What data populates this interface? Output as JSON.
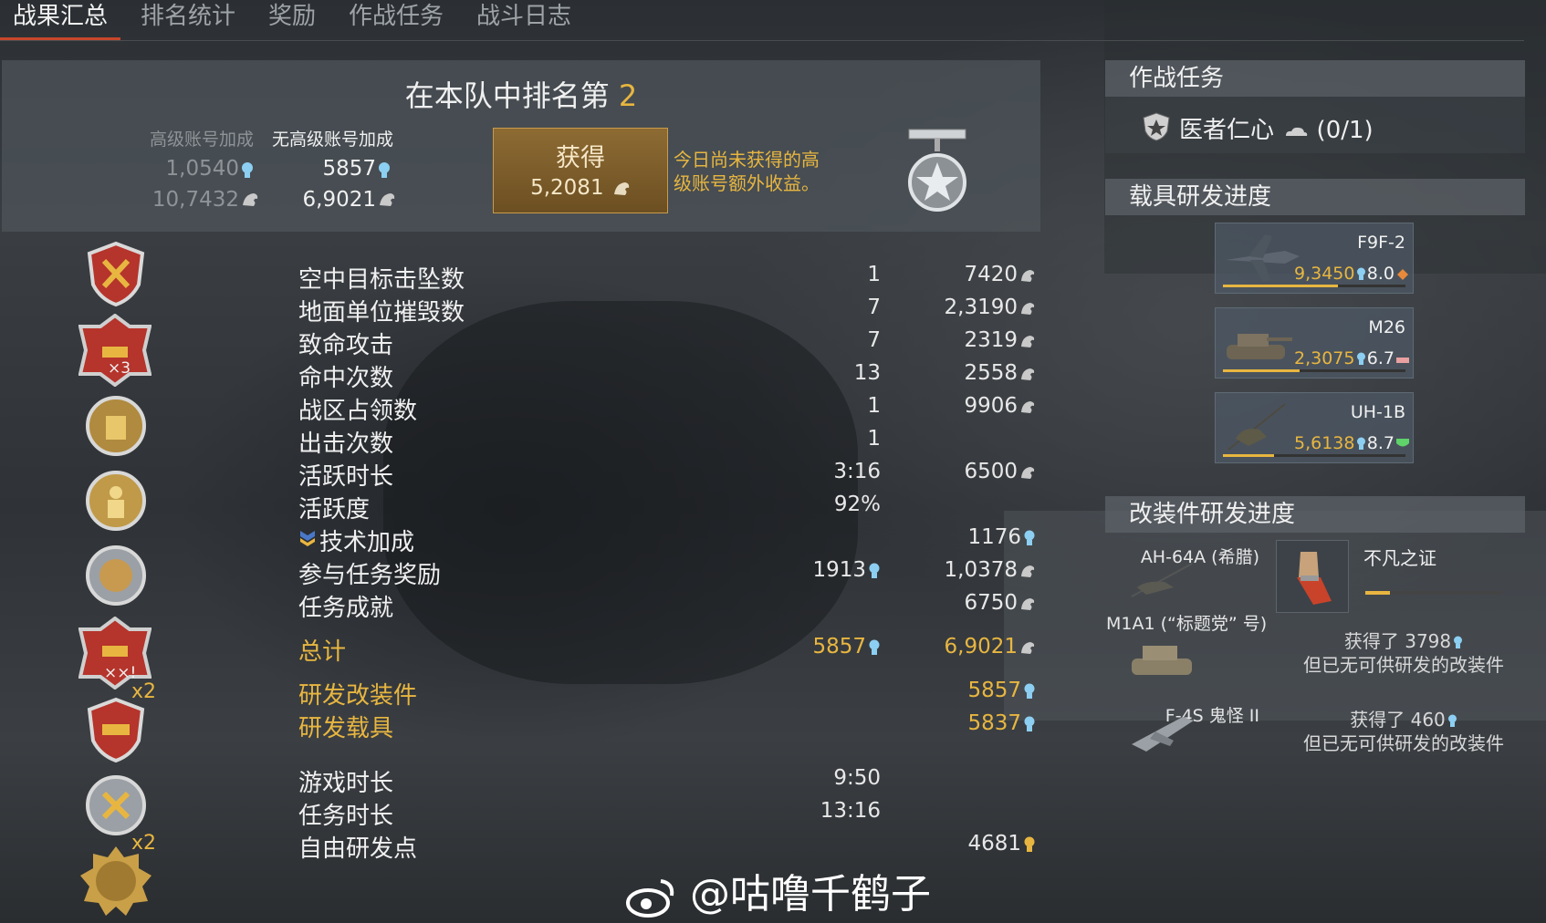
{
  "tabs": [
    "战果汇总",
    "排名统计",
    "奖励",
    "作战任务",
    "战斗日志"
  ],
  "header": {
    "rank_text": "在本队中排名第",
    "rank_value": "2",
    "premium_label": "高级账号加成",
    "no_premium_label": "无高级账号加成",
    "premium_rp": "1,0540",
    "premium_sl": "10,7432",
    "no_premium_rp": "5857",
    "no_premium_sl": "6,9021",
    "obtain_label": "获得",
    "obtain_value": "5,2081",
    "obtain_note": "今日尚未获得的高级账号额外收益。"
  },
  "stats": [
    {
      "label": "空中目标击坠数",
      "count": "1",
      "reward": "7420"
    },
    {
      "label": "地面单位摧毁数",
      "count": "7",
      "reward": "2,3190"
    },
    {
      "label": "致命攻击",
      "count": "7",
      "reward": "2319"
    },
    {
      "label": "命中次数",
      "count": "13",
      "reward": "2558"
    },
    {
      "label": "战区占领数",
      "count": "1",
      "reward": "9906"
    },
    {
      "label": "出击次数",
      "count": "1",
      "reward": ""
    },
    {
      "label": "活跃时长",
      "count": "3:16",
      "reward": "6500"
    },
    {
      "label": "活跃度",
      "count": "92%",
      "reward": ""
    },
    {
      "label": "技术加成",
      "count": "",
      "reward": "1176"
    },
    {
      "label": "参与任务奖励",
      "count": "1913",
      "reward": "1,0378"
    },
    {
      "label": "任务成就",
      "count": "",
      "reward": "6750"
    }
  ],
  "total": {
    "label": "总计",
    "rp": "5857",
    "sl": "6,9021"
  },
  "research": [
    {
      "label": "研发改装件",
      "value": "5857"
    },
    {
      "label": "研发载具",
      "value": "5837"
    }
  ],
  "times": [
    {
      "label": "游戏时长",
      "value": "9:50"
    },
    {
      "label": "任务时长",
      "value": "13:16"
    },
    {
      "label": "自由研发点",
      "value": "4681"
    }
  ],
  "medal_multipliers": [
    "×3",
    "××!",
    "x2",
    "x2"
  ],
  "missions": {
    "title": "作战任务",
    "item": "医者仁心",
    "progress": "(0/1)"
  },
  "vehicles": {
    "title": "载具研发进度",
    "items": [
      {
        "name": "F9F-2",
        "rp": "9,3450",
        "br": "8.0",
        "progress": 0.63
      },
      {
        "name": "M26",
        "rp": "2,3075",
        "br": "6.7",
        "progress": 0.42
      },
      {
        "name": "UH-1B",
        "rp": "5,6138",
        "br": "8.7",
        "progress": 0.28
      }
    ]
  },
  "mods": {
    "title": "改装件研发进度",
    "items": [
      {
        "vehicle": "AH-64A (希腊)",
        "mod_name": "不凡之证",
        "progress": 0.18
      },
      {
        "vehicle": "M1A1 (“标题党” 号)",
        "msg_line1": "获得了 3798",
        "msg_line2": "但已无可供研发的改装件"
      },
      {
        "vehicle": "F-4S 鬼怪 II",
        "msg_line1": "获得了 460",
        "msg_line2": "但已无可供研发的改装件"
      }
    ]
  },
  "watermark": "@咕噜千鹤子",
  "colors": {
    "accent": "#e8b640",
    "tab_underline": "#c8462a"
  }
}
